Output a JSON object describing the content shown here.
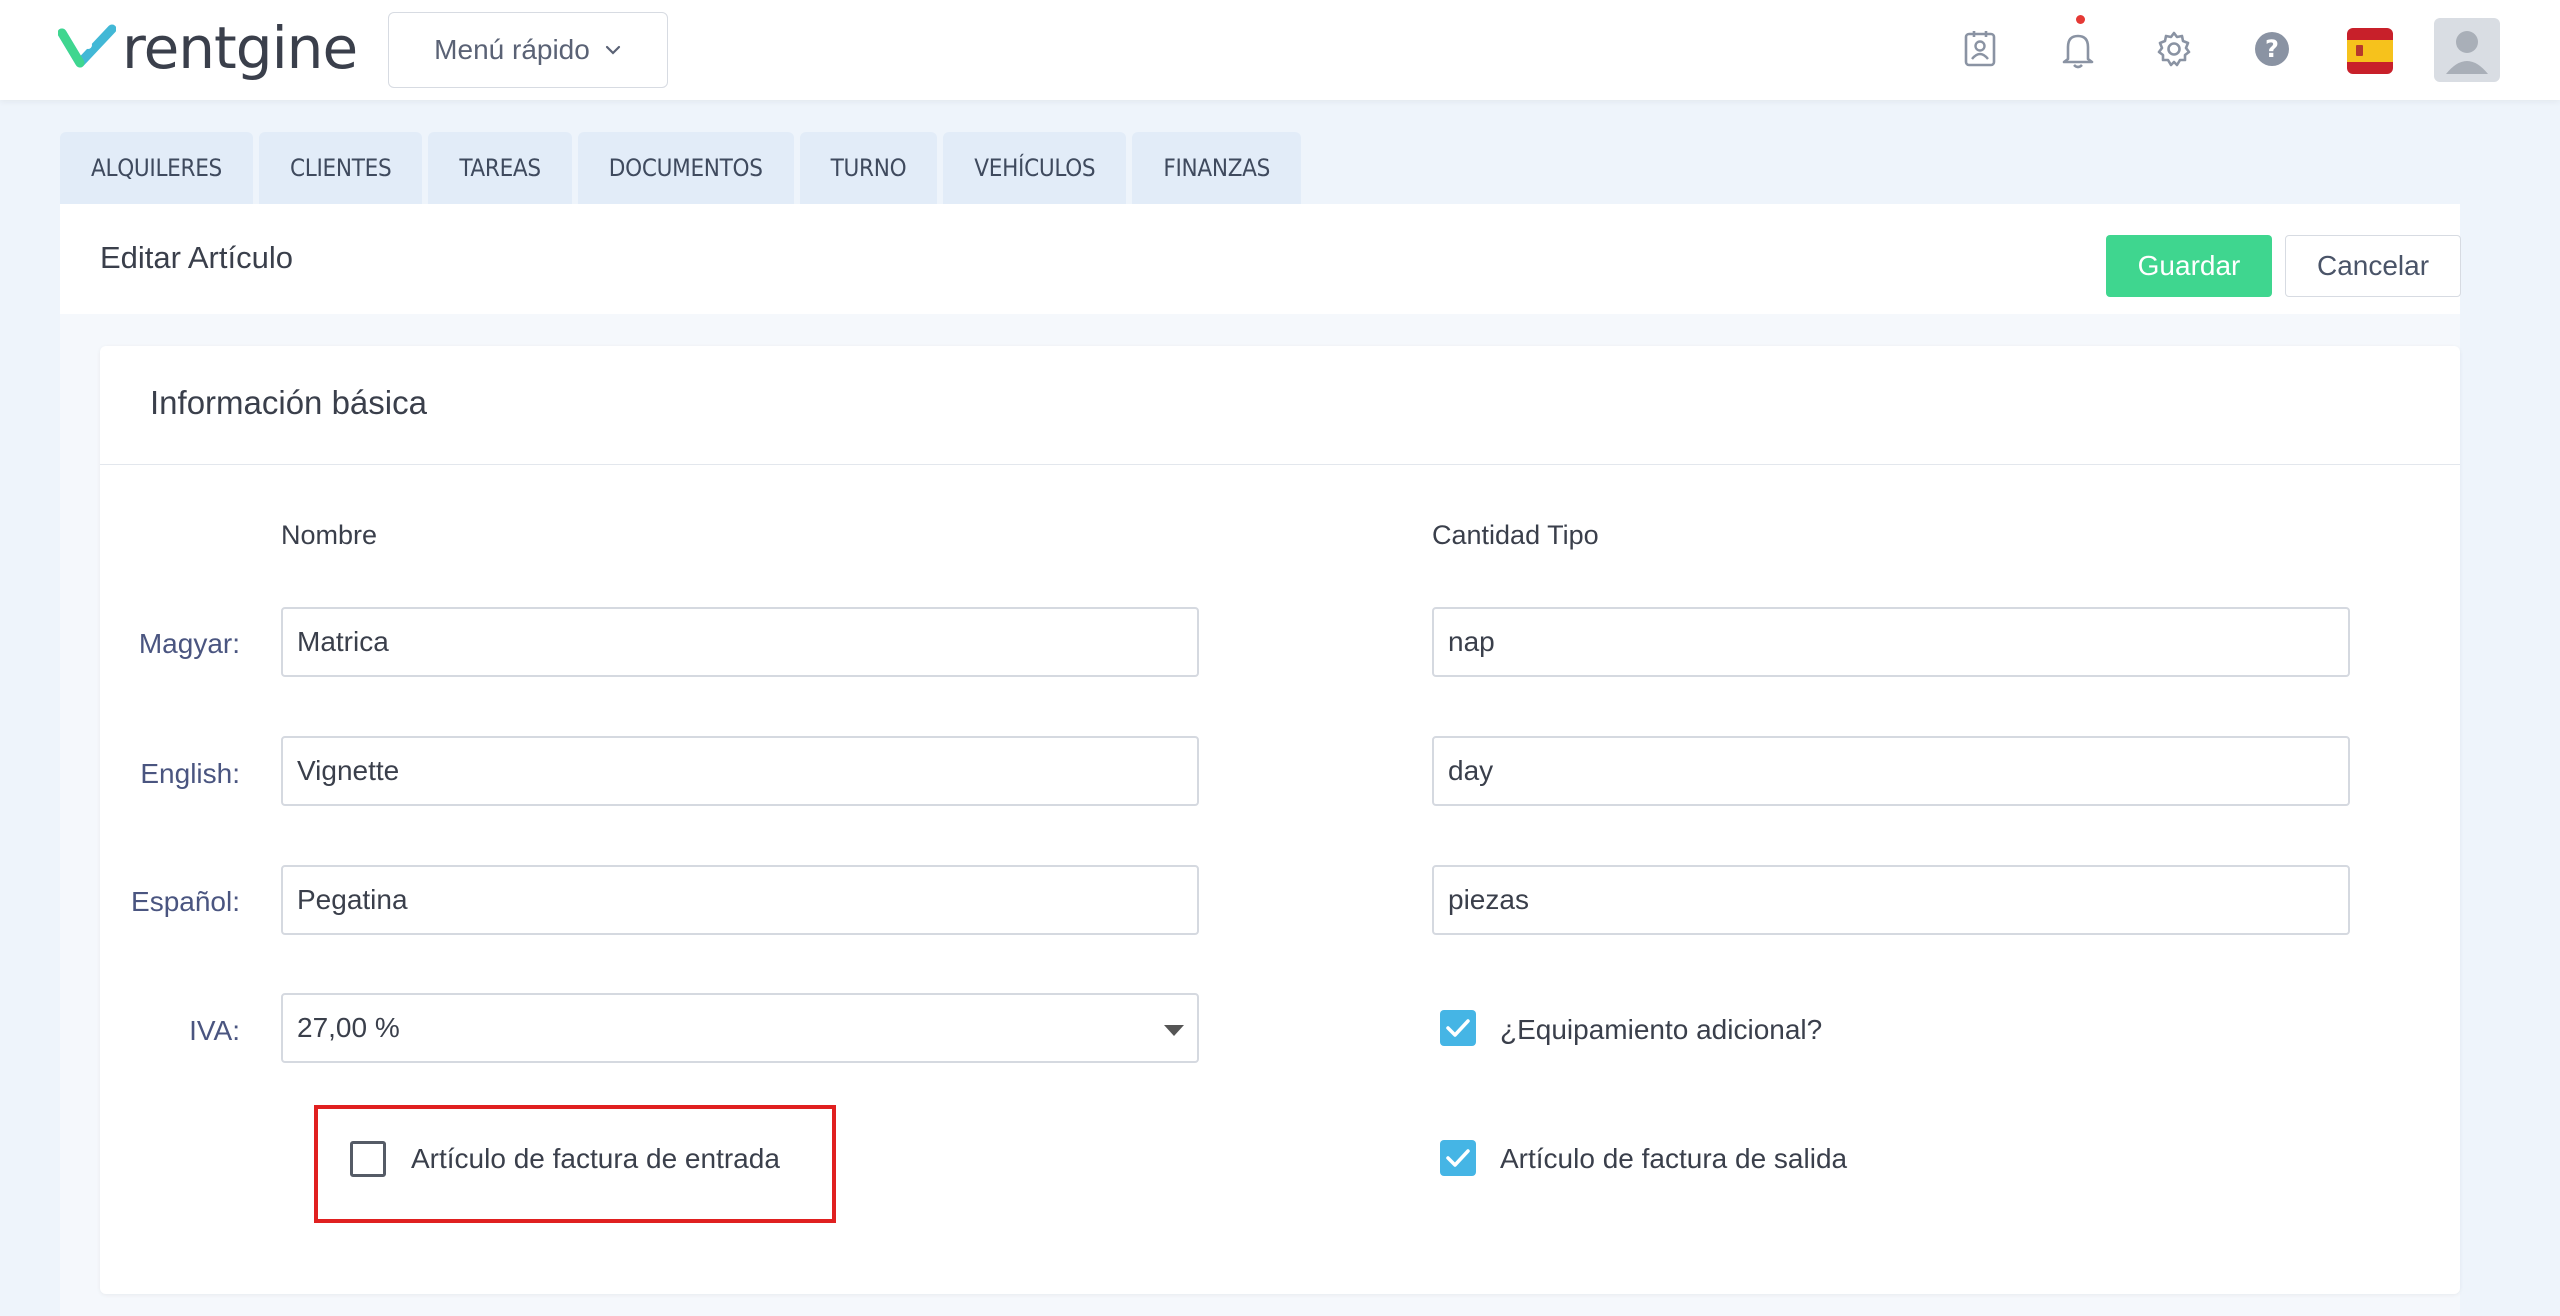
{
  "app": {
    "logo_text": "rentgine",
    "quick_menu_label": "Menú rápido"
  },
  "header_icons": [
    "contact-card-icon",
    "bell-icon",
    "gear-icon",
    "help-icon",
    "spain-flag-icon",
    "user-avatar-icon"
  ],
  "tabs": [
    {
      "label": "ALQUILERES"
    },
    {
      "label": "CLIENTES"
    },
    {
      "label": "TAREAS"
    },
    {
      "label": "DOCUMENTOS"
    },
    {
      "label": "TURNO"
    },
    {
      "label": "VEHÍCULOS"
    },
    {
      "label": "FINANZAS"
    }
  ],
  "page": {
    "title": "Editar Artículo",
    "save_label": "Guardar",
    "cancel_label": "Cancelar"
  },
  "form": {
    "section_title": "Información básica",
    "col_name_header": "Nombre",
    "col_qty_header": "Cantidad Tipo",
    "rows": [
      {
        "label": "Magyar:",
        "name": "Matrica",
        "qty": "nap"
      },
      {
        "label": "English:",
        "name": "Vignette",
        "qty": "day"
      },
      {
        "label": "Español:",
        "name": "Pegatina",
        "qty": "piezas"
      }
    ],
    "vat_label": "IVA:",
    "vat_value": "27,00 %",
    "extra_equipment_label": "¿Equipamiento adicional?",
    "extra_equipment_checked": true,
    "incoming_invoice_label": "Artículo de factura de entrada",
    "incoming_invoice_checked": false,
    "outgoing_invoice_label": "Artículo de factura de salida",
    "outgoing_invoice_checked": true
  },
  "colors": {
    "accent_green": "#3fd68f",
    "checkbox_blue": "#45b5e5",
    "highlight_red": "#e02020",
    "background": "#eef4fb"
  }
}
